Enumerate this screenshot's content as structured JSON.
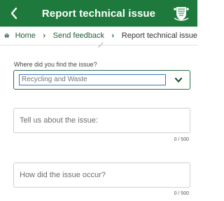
{
  "header": {
    "title": "Report technical issue",
    "back_icon": "chevron-left-icon",
    "logo_icon": "crest-logo-icon",
    "background": "#1e7a3c"
  },
  "breadcrumb": {
    "home_icon": "home-icon",
    "items": [
      "Home",
      "Send feedback",
      "Report technical issue"
    ],
    "separator_icon": "chevron-right-icon"
  },
  "form": {
    "location_label": "Where did you find the issue?",
    "location_value": "Recycling and Waste",
    "about_placeholder": "Tell us about the issue:",
    "about_counter": "0 / 500",
    "occur_placeholder": "How did the issue occur?",
    "occur_counter": "0 / 500"
  }
}
